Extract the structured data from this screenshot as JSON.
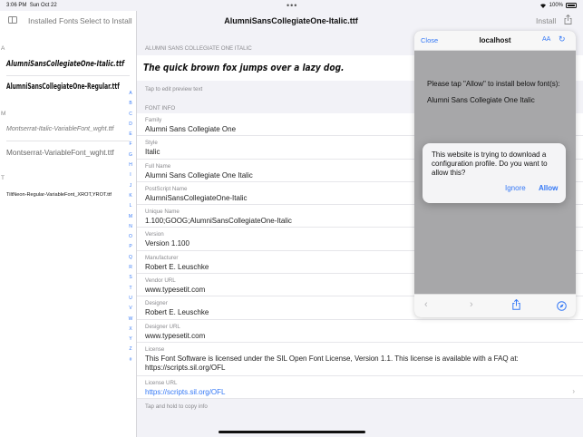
{
  "status_bar": {
    "time": "3:06 PM",
    "date": "Sun Oct 22",
    "battery": "100%",
    "multitask": "•••"
  },
  "sidebar": {
    "tab_installed": "Installed Fonts",
    "tab_select": "Select to Install",
    "sections": [
      {
        "letter": "A",
        "fonts": [
          "AlumniSansCollegiateOne-Italic.ttf",
          "AlumniSansCollegiateOne-Regular.ttf"
        ]
      },
      {
        "letter": "M",
        "fonts": [
          "Montserrat-Italic-VariableFont_wght.ttf",
          "Montserrat-VariableFont_wght.ttf"
        ]
      },
      {
        "letter": "T",
        "fonts": [
          "TiltNeon-Regular-VariableFont_XROT,YROT.ttf"
        ]
      }
    ],
    "index_letters": [
      "A",
      "B",
      "C",
      "D",
      "E",
      "F",
      "G",
      "H",
      "I",
      "J",
      "K",
      "L",
      "M",
      "N",
      "O",
      "P",
      "Q",
      "R",
      "S",
      "T",
      "U",
      "V",
      "W",
      "X",
      "Y",
      "Z",
      "#"
    ]
  },
  "header": {
    "title": "AlumniSansCollegiateOne-Italic.ttf",
    "install_label": "Install"
  },
  "preview": {
    "section_label": "ALUMNI SANS COLLEGIATE ONE ITALIC",
    "sample_text": "The quick brown fox jumps over a lazy dog.",
    "hint": "Tap to edit preview text"
  },
  "font_info": {
    "section_label": "FONT INFO",
    "rows": [
      {
        "key": "Family",
        "value": "Alumni Sans Collegiate One"
      },
      {
        "key": "Style",
        "value": "Italic"
      },
      {
        "key": "Full Name",
        "value": "Alumni Sans Collegiate One Italic"
      },
      {
        "key": "PostScript Name",
        "value": "AlumniSansCollegiateOne-Italic"
      },
      {
        "key": "Unique Name",
        "value": "1.100;GOOG;AlumniSansCollegiateOne-Italic"
      },
      {
        "key": "Version",
        "value": "Version 1.100"
      },
      {
        "key": "Manufacturer",
        "value": "Robert E. Leuschke"
      },
      {
        "key": "Vendor URL",
        "value": "www.typesetit.com"
      },
      {
        "key": "Designer",
        "value": "Robert E. Leuschke"
      },
      {
        "key": "Designer URL",
        "value": "www.typesetit.com"
      },
      {
        "key": "License",
        "value": "This Font Software is licensed under the SIL Open Font License, Version 1.1. This license is available with a FAQ at: https://scripts.sil.org/OFL"
      },
      {
        "key": "License URL",
        "value": "https://scripts.sil.org/OFL"
      }
    ],
    "footer_hint": "Tap and hold to copy info"
  },
  "safari": {
    "close_label": "Close",
    "host": "localhost",
    "text_size_label": "AA",
    "message": "Please tap \"Allow\" to install below font(s):",
    "font_name": "Alumni Sans Collegiate One Italic"
  },
  "alert": {
    "message": "This website is trying to download a configuration profile. Do you want to allow this?",
    "ignore_label": "Ignore",
    "allow_label": "Allow"
  },
  "colors": {
    "accent": "#3478f6",
    "background": "#f2f2f7",
    "secondary_text": "#8a8a8e",
    "safari_dim": "#a7a7a9"
  }
}
